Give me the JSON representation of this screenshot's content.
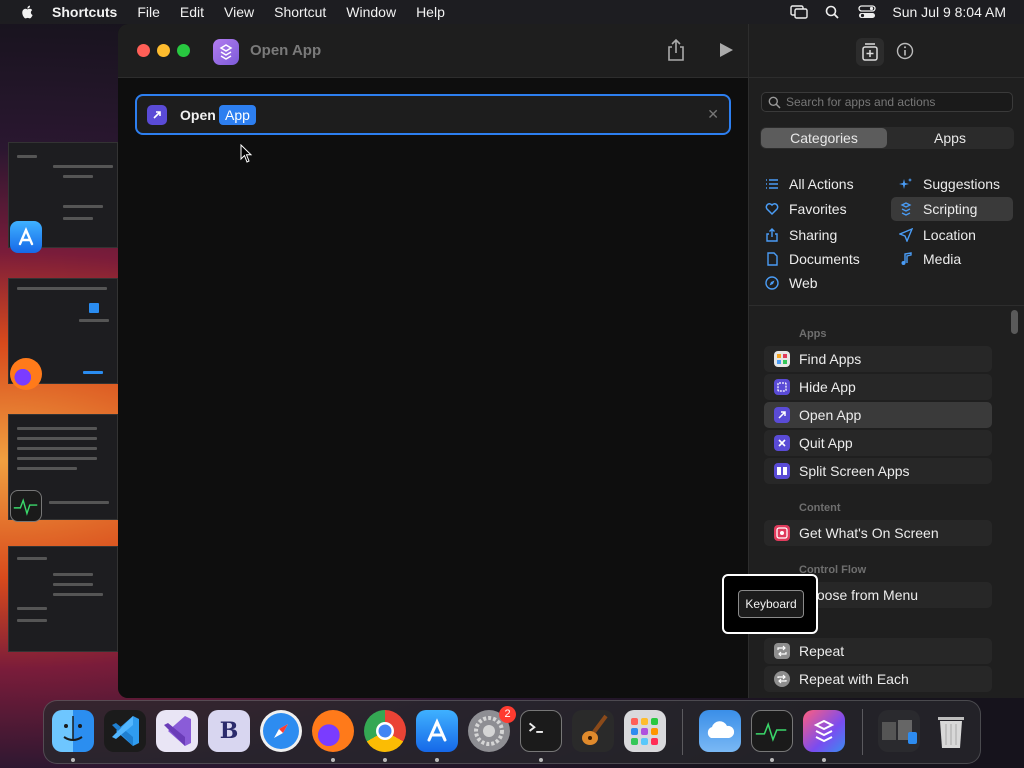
{
  "menubar": {
    "app_name": "Shortcuts",
    "items": [
      "File",
      "Edit",
      "View",
      "Shortcut",
      "Window",
      "Help"
    ],
    "clock": "Sun Jul 9  8:04 AM"
  },
  "window": {
    "title": "Open App",
    "action": {
      "verb": "Open",
      "token": "App",
      "remove_glyph": "✕"
    }
  },
  "sidebar": {
    "search_placeholder": "Search for apps and actions",
    "segments": [
      "Categories",
      "Apps"
    ],
    "active_segment": "Categories",
    "categories_left": [
      "All Actions",
      "Favorites",
      "Sharing",
      "Documents",
      "Web"
    ],
    "categories_right": [
      "Suggestions",
      "Scripting",
      "Location",
      "Media"
    ],
    "selected_category": "Scripting",
    "sections": {
      "apps": {
        "header": "Apps",
        "items": [
          "Find Apps",
          "Hide App",
          "Open App",
          "Quit App",
          "Split Screen Apps"
        ],
        "selected": "Open App"
      },
      "content": {
        "header": "Content",
        "items": [
          "Get What's On Screen"
        ]
      },
      "control_flow": {
        "header": "Control Flow",
        "items": [
          "Choose from Menu",
          "Repeat",
          "Repeat with Each"
        ]
      }
    }
  },
  "tooltip": {
    "label": "Keyboard"
  },
  "dock": {
    "apps": [
      "finder-icon",
      "vscode-icon",
      "visual-studio-icon",
      "bbedit-icon",
      "safari-icon",
      "firefox-icon",
      "chrome-icon",
      "app-store-icon",
      "system-settings-icon",
      "terminal-icon",
      "garageband-icon",
      "launchpad-icon",
      "weather-icon",
      "activity-monitor-icon",
      "shortcuts-icon",
      "finder-stack-icon",
      "trash-icon"
    ],
    "settings_badge": "2",
    "bbedit_letter": "B"
  },
  "colors": {
    "accent": "#2d7ff0",
    "close": "#ff5f57",
    "minimize": "#febc2e",
    "maximize": "#28c840"
  }
}
